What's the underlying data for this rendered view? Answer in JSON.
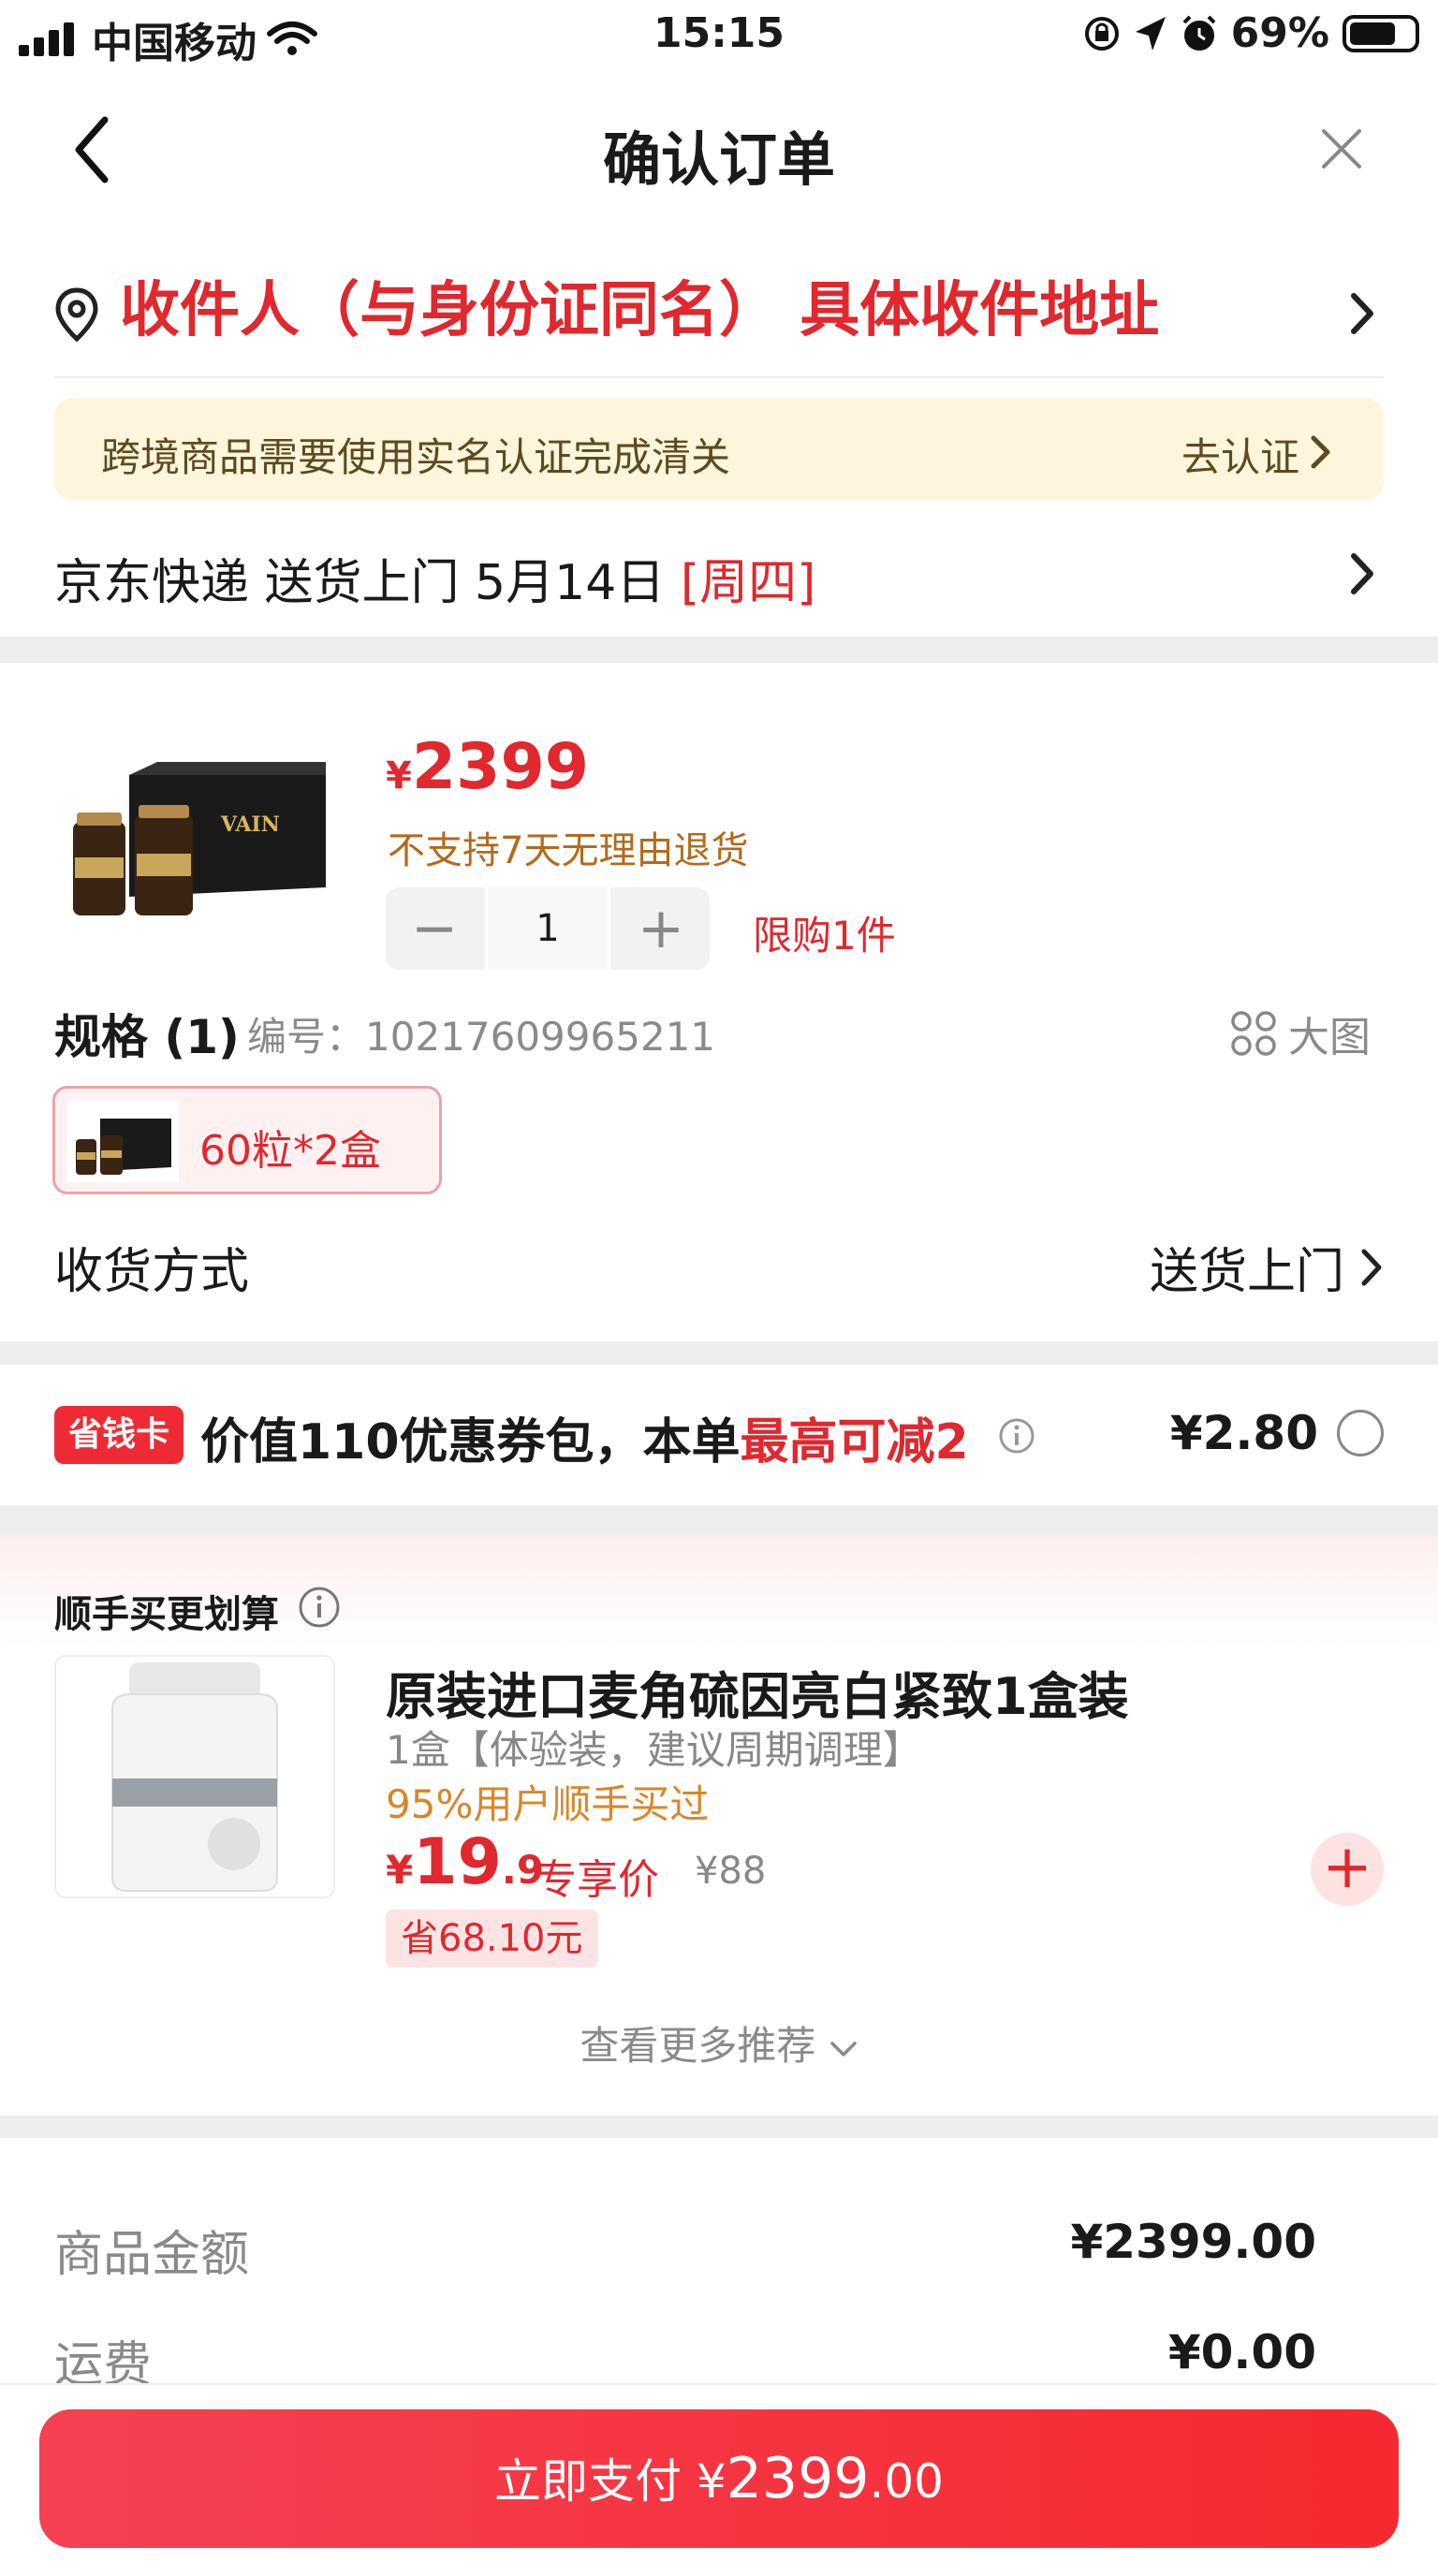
{
  "status_bar": {
    "carrier": "中国移动",
    "time": "15:15",
    "battery": "69%"
  },
  "header": {
    "title": "确认订单"
  },
  "address": {
    "recipient": "收件人（与身份证同名） 具体收件地址",
    "notice": "跨境商品需要使用实名认证完成清关",
    "notice_link": "去认证",
    "delivery": "京东快递 送货上门 5月14日",
    "delivery_day": "[周四]"
  },
  "product": {
    "currency": "¥",
    "price": "2399",
    "return_policy": "不支持7天无理由退货",
    "quantity": "1",
    "limit": "限购1件",
    "spec_label": "规格 (1)",
    "spec_code": "编号：10217609965211",
    "big_image": "大图",
    "spec_option": "60粒*2盒",
    "receive_label": "收货方式",
    "receive_value": "送货上门"
  },
  "saver_card": {
    "badge": "省钱卡",
    "text_prefix": "价值110优惠券包，本单",
    "text_highlight": "最高可减2",
    "price": "¥2.80"
  },
  "addon": {
    "title": "顺手买更划算",
    "name": "原装进口麦角硫因亮白紧致1盒装",
    "desc": "1盒【体验装，建议周期调理】",
    "bought": "95%用户顺手买过",
    "price_symbol": "¥",
    "price_int": "19",
    "price_dec": ".9",
    "price_tag": "专享价",
    "orig_price": "¥88",
    "save": "省68.10元",
    "more": "查看更多推荐"
  },
  "summary": {
    "goods_label": "商品金额",
    "goods_value": "¥2399.00",
    "shipping_label": "运费",
    "shipping_value": "¥0.00"
  },
  "pay": {
    "label": "立即支付",
    "currency": "¥",
    "amount": "2399",
    "decimals": ".00"
  },
  "colors": {
    "accent_red": "#e0282e",
    "notice_bg": "#fdf6dc",
    "pay_button": "#f5292f"
  }
}
